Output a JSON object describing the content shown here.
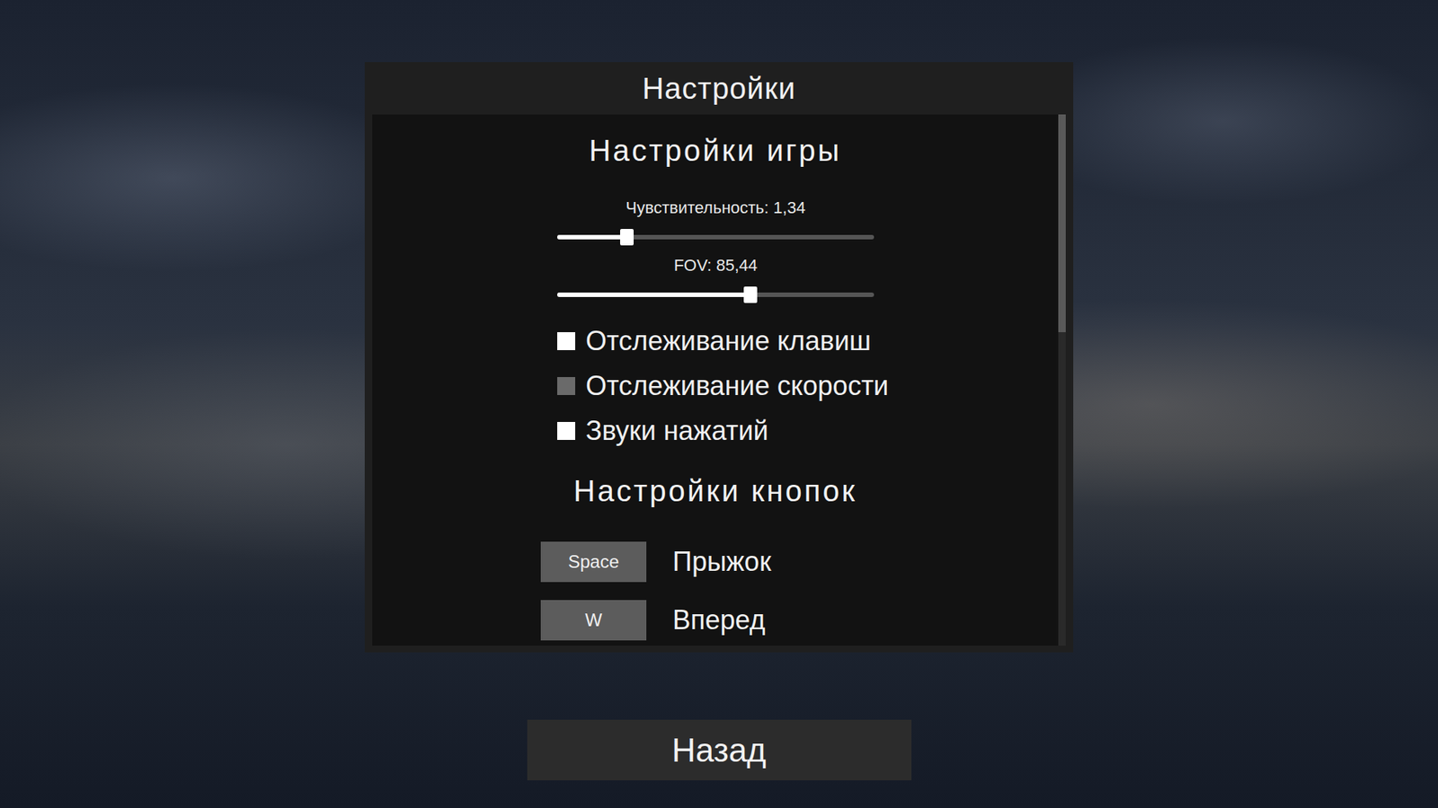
{
  "window": {
    "title": "Настройки"
  },
  "sections": [
    {
      "title": "Настройки игры",
      "items": [
        {
          "kind": "slider",
          "label": "Чувствительность: 1,34",
          "level": 0.22
        },
        {
          "kind": "slider",
          "label": "FOV: 85,44",
          "level": 0.61
        },
        {
          "kind": "checkbox",
          "label": "Отслеживание клавиш",
          "checked": true
        },
        {
          "kind": "checkbox",
          "label": "Отслеживание скорости",
          "checked": false
        },
        {
          "kind": "checkbox",
          "label": "Звуки нажатий",
          "checked": true
        }
      ]
    },
    {
      "title": "Настройки кнопок",
      "items": [
        {
          "kind": "keybind",
          "key": "Space",
          "label": "Прыжок"
        },
        {
          "kind": "keybind",
          "key": "W",
          "label": "Вперед"
        }
      ]
    }
  ],
  "scrollbar": {
    "level": 0.41
  },
  "buttons": [
    "Назад"
  ]
}
